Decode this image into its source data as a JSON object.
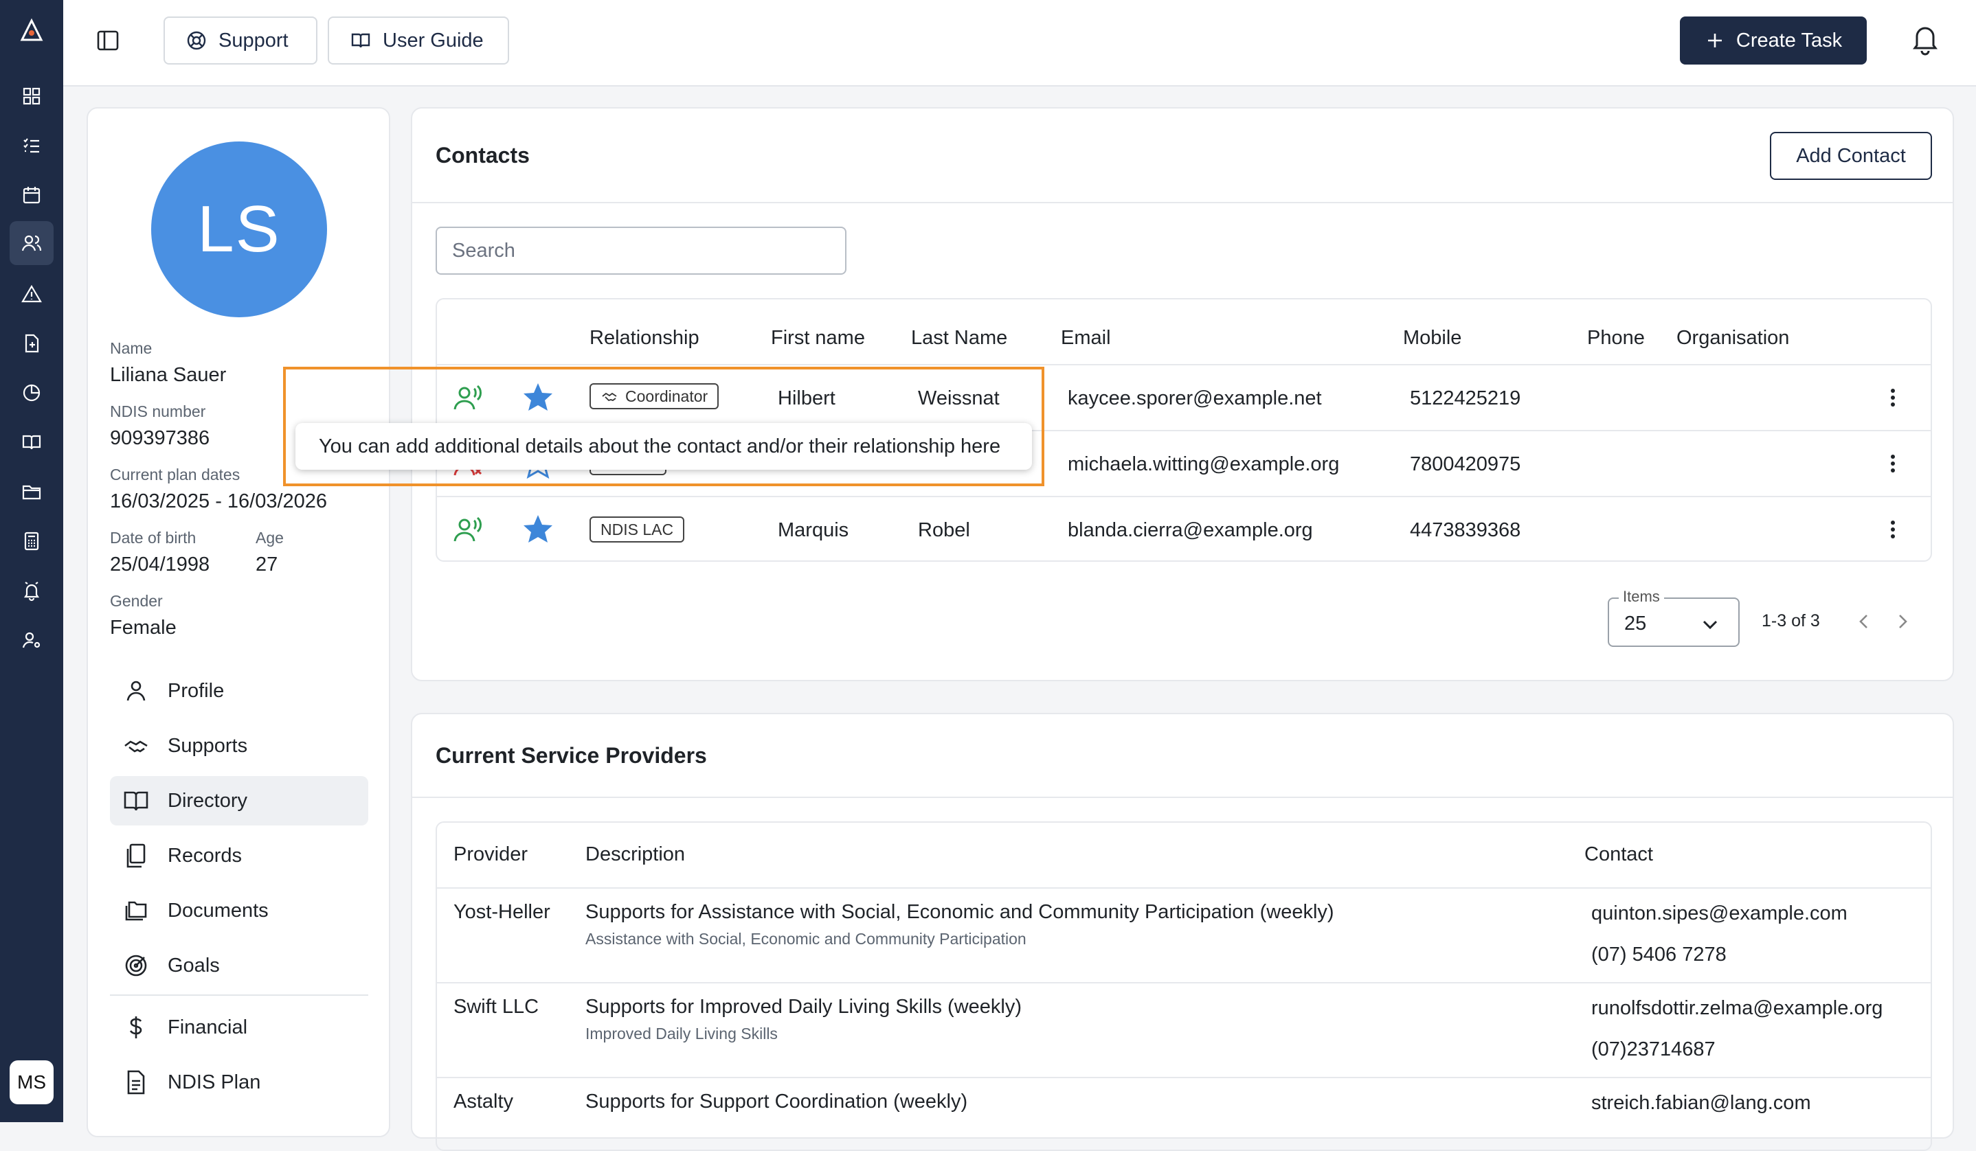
{
  "app": {
    "user_initials": "MS"
  },
  "topbar": {
    "support_label": "Support",
    "user_guide_label": "User Guide",
    "create_task_label": "Create Task"
  },
  "profile": {
    "initials": "LS",
    "name_label": "Name",
    "name": "Liliana Sauer",
    "ndis_label": "NDIS number",
    "ndis": "909397386",
    "plan_label": "Current plan dates",
    "plan_dates": "16/03/2025 - 16/03/2026",
    "dob_label": "Date of birth",
    "dob": "25/04/1998",
    "age_label": "Age",
    "age": "27",
    "gender_label": "Gender",
    "gender": "Female"
  },
  "nav": [
    {
      "label": "Profile",
      "icon": "person-icon"
    },
    {
      "label": "Supports",
      "icon": "handshake-icon"
    },
    {
      "label": "Directory",
      "icon": "book-icon",
      "active": true
    },
    {
      "label": "Records",
      "icon": "copy-icon"
    },
    {
      "label": "Documents",
      "icon": "folders-icon"
    },
    {
      "label": "Goals",
      "icon": "target-icon"
    },
    {
      "label": "Financial",
      "icon": "dollar-icon"
    },
    {
      "label": "NDIS Plan",
      "icon": "document-icon"
    }
  ],
  "contacts": {
    "title": "Contacts",
    "add_label": "Add Contact",
    "search_placeholder": "Search",
    "columns": {
      "relationship": "Relationship",
      "first_name": "First name",
      "last_name": "Last Name",
      "email": "Email",
      "mobile": "Mobile",
      "phone": "Phone",
      "organisation": "Organisation"
    },
    "rows": [
      {
        "relationship": "Coordinator",
        "first_name": "Hilbert",
        "last_name": "Weissnat",
        "email": "kaycee.sporer@example.net",
        "mobile": "5122425219",
        "phone": "",
        "organisation": ""
      },
      {
        "relationship": "",
        "first_name": "",
        "last_name": "",
        "email": "michaela.witting@example.org",
        "mobile": "7800420975",
        "phone": "",
        "organisation": ""
      },
      {
        "relationship": "NDIS LAC",
        "first_name": "Marquis",
        "last_name": "Robel",
        "email": "blanda.cierra@example.org",
        "mobile": "4473839368",
        "phone": "",
        "organisation": ""
      }
    ],
    "tooltip": "You can add additional details about the contact and/or their relationship here",
    "items_label": "Items",
    "items_value": "25",
    "range_text": "1-3 of 3"
  },
  "providers": {
    "title": "Current Service Providers",
    "columns": {
      "provider": "Provider",
      "description": "Description",
      "contact": "Contact"
    },
    "rows": [
      {
        "provider": "Yost-Heller",
        "title": "Supports for Assistance with Social, Economic and Community Participation (weekly)",
        "subtitle": "Assistance with Social, Economic and Community Participation",
        "email": "quinton.sipes@example.com",
        "phone": "(07) 5406 7278"
      },
      {
        "provider": "Swift LLC",
        "title": "Supports for Improved Daily Living Skills (weekly)",
        "subtitle": "Improved Daily Living Skills",
        "email": "runolfsdottir.zelma@example.org",
        "phone": "(07)23714687"
      },
      {
        "provider": "Astalty",
        "title": "Supports for Support Coordination (weekly)",
        "subtitle": "",
        "email": "streich.fabian@lang.com",
        "phone": ""
      }
    ]
  },
  "colors": {
    "rail": "#1e2b45",
    "accent": "#4a90e2",
    "highlight": "#f0922b",
    "contact_icon_green": "#2e9e4f",
    "star_blue": "#3d86d9"
  }
}
